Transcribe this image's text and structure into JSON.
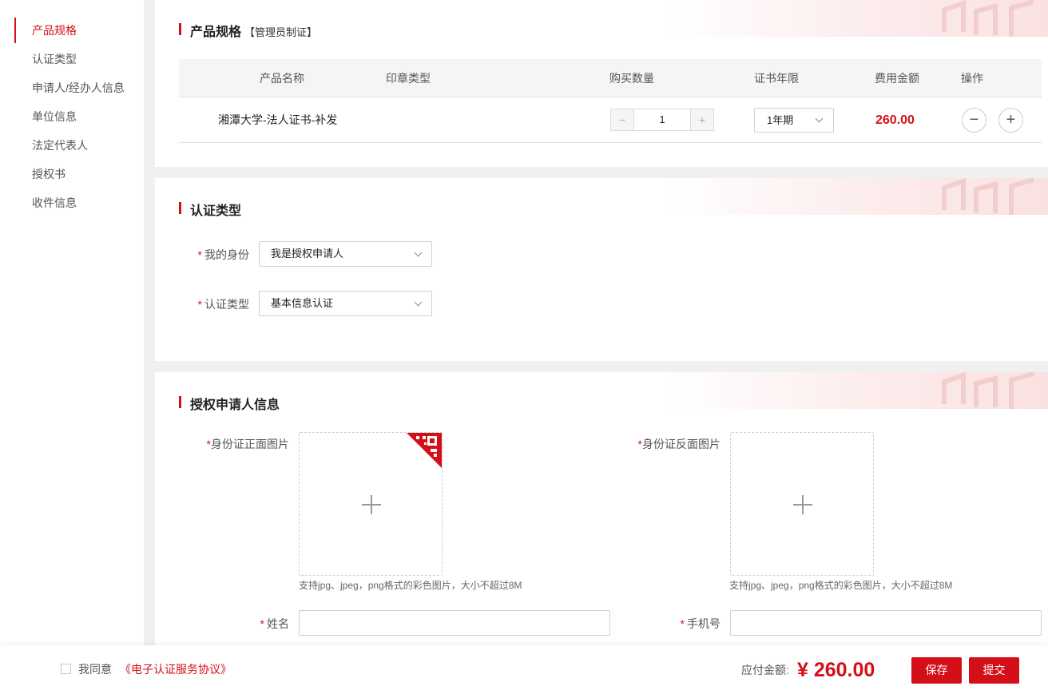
{
  "sidebar": {
    "items": [
      {
        "label": "产品规格",
        "active": true
      },
      {
        "label": "认证类型"
      },
      {
        "label": "申请人/经办人信息"
      },
      {
        "label": "单位信息"
      },
      {
        "label": "法定代表人"
      },
      {
        "label": "授权书"
      },
      {
        "label": "收件信息"
      }
    ]
  },
  "spec": {
    "title": "产品规格",
    "subtitle": "【管理员制证】",
    "columns": [
      "产品名称",
      "印章类型",
      "购买数量",
      "证书年限",
      "费用金额",
      "操作"
    ],
    "row": {
      "product_name": "湘潭大学-法人证书-补发",
      "seal_type": "",
      "quantity": "1",
      "minus": "−",
      "plus": "+",
      "years": "1年期",
      "amount": "260.00",
      "op_remove": "−",
      "op_add": "+"
    }
  },
  "auth": {
    "title": "认证类型",
    "identity_label": "我的身份",
    "identity_value": "我是授权申请人",
    "type_label": "认证类型",
    "type_value": "基本信息认证"
  },
  "applicant": {
    "title": "授权申请人信息",
    "id_front_label": "身份证正面图片",
    "id_back_label": "身份证反面图片",
    "upload_hint": "支持jpg、jpeg，png格式的彩色图片，大小不超过8M",
    "name_label": "姓名",
    "phone_label": "手机号",
    "required_mark": "*"
  },
  "footer": {
    "agree_text": "我同意",
    "agreement_link": "《电子认证服务协议》",
    "pay_label": "应付金额:",
    "pay_amount": "¥ 260.00",
    "save_label": "保存",
    "submit_label": "提交"
  },
  "colors": {
    "accent": "#d40f18"
  }
}
